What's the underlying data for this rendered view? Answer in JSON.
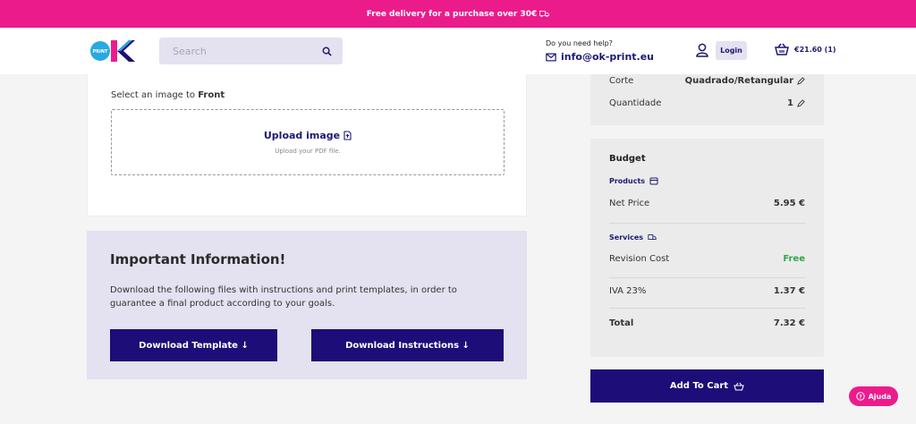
{
  "promo": {
    "text": "Free delivery for a purchase over 30€"
  },
  "header": {
    "logo_text": "PRINT",
    "search_placeholder": "Search",
    "help_question": "Do you need help?",
    "email": "info@ok-print.eu",
    "login_label": "Login",
    "cart_label": "€21.60 (1)"
  },
  "upload": {
    "label_prefix": "Select an image to ",
    "label_side": "Front",
    "upload_title": "Upload image",
    "upload_sub": "Upload your PDF file."
  },
  "info": {
    "heading": "Important Information!",
    "body": "Download the following files with instructions and print templates, in order to guarantee a final product according to your goals.",
    "template_btn": "Download Template ↓",
    "instructions_btn": "Download Instructions ↓"
  },
  "options": [
    {
      "label": "Corte",
      "value": "Quadrado/Retangular"
    },
    {
      "label": "Quantidade",
      "value": "1"
    }
  ],
  "budget": {
    "title": "Budget",
    "products_label": "Products",
    "net_price_label": "Net Price",
    "net_price_value": "5.95 €",
    "services_label": "Services",
    "revision_label": "Revision Cost",
    "revision_value": "Free",
    "iva_label": "IVA 23%",
    "iva_value": "1.37 €",
    "total_label": "Total",
    "total_value": "7.32 €"
  },
  "add_to_cart": "Add To Cart",
  "help_button": "Ajuda",
  "colors": {
    "brand_pink": "#ec1b8c",
    "brand_navy": "#1d0d78",
    "free_green": "#2ea84a"
  }
}
